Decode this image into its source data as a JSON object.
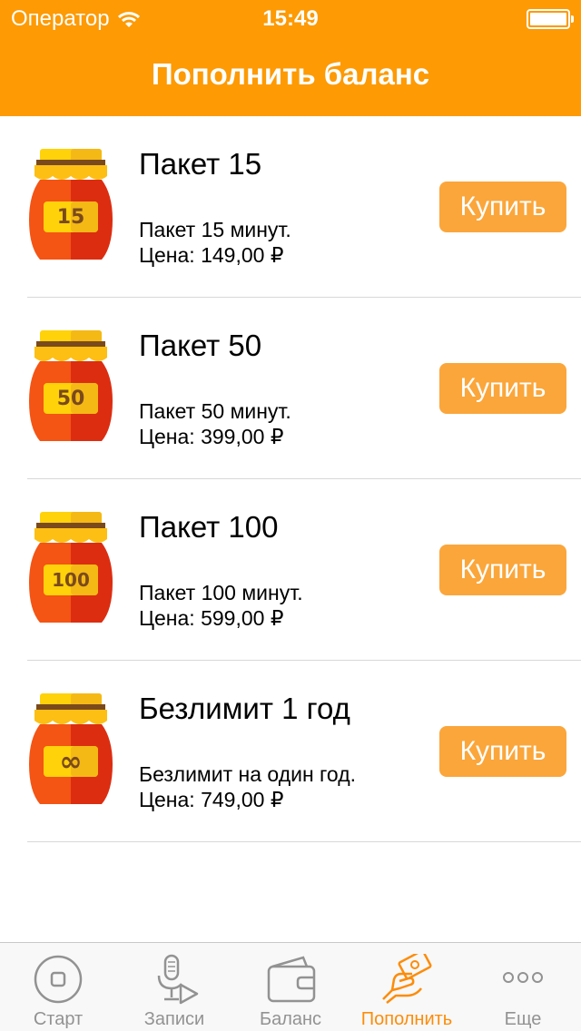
{
  "status_bar": {
    "carrier": "Оператор",
    "time": "15:49"
  },
  "header": {
    "title": "Пополнить баланс"
  },
  "packages": [
    {
      "title": "Пакет 15",
      "jar_label": "15",
      "description": "Пакет 15 минут.",
      "price": "Цена: 149,00 ₽",
      "button": "Купить"
    },
    {
      "title": "Пакет 50",
      "jar_label": "50",
      "description": "Пакет 50 минут.",
      "price": "Цена: 399,00 ₽",
      "button": "Купить"
    },
    {
      "title": "Пакет 100",
      "jar_label": "100",
      "description": "Пакет 100 минут.",
      "price": "Цена: 599,00 ₽",
      "button": "Купить"
    },
    {
      "title": "Безлимит 1 год",
      "jar_label": "∞",
      "description": "Безлимит на один год.",
      "price": "Цена: 749,00 ₽",
      "button": "Купить"
    }
  ],
  "tabs": [
    {
      "label": "Старт",
      "icon": "stop-circle-icon",
      "active": false
    },
    {
      "label": "Записи",
      "icon": "mic-play-icon",
      "active": false
    },
    {
      "label": "Баланс",
      "icon": "wallet-icon",
      "active": false
    },
    {
      "label": "Пополнить",
      "icon": "hand-money-icon",
      "active": true
    },
    {
      "label": "Еще",
      "icon": "more-dots-icon",
      "active": false
    }
  ],
  "colors": {
    "accent": "#fd9a04",
    "button": "#fba63b",
    "tab_inactive": "#929292",
    "tab_active": "#fd8c0a"
  }
}
